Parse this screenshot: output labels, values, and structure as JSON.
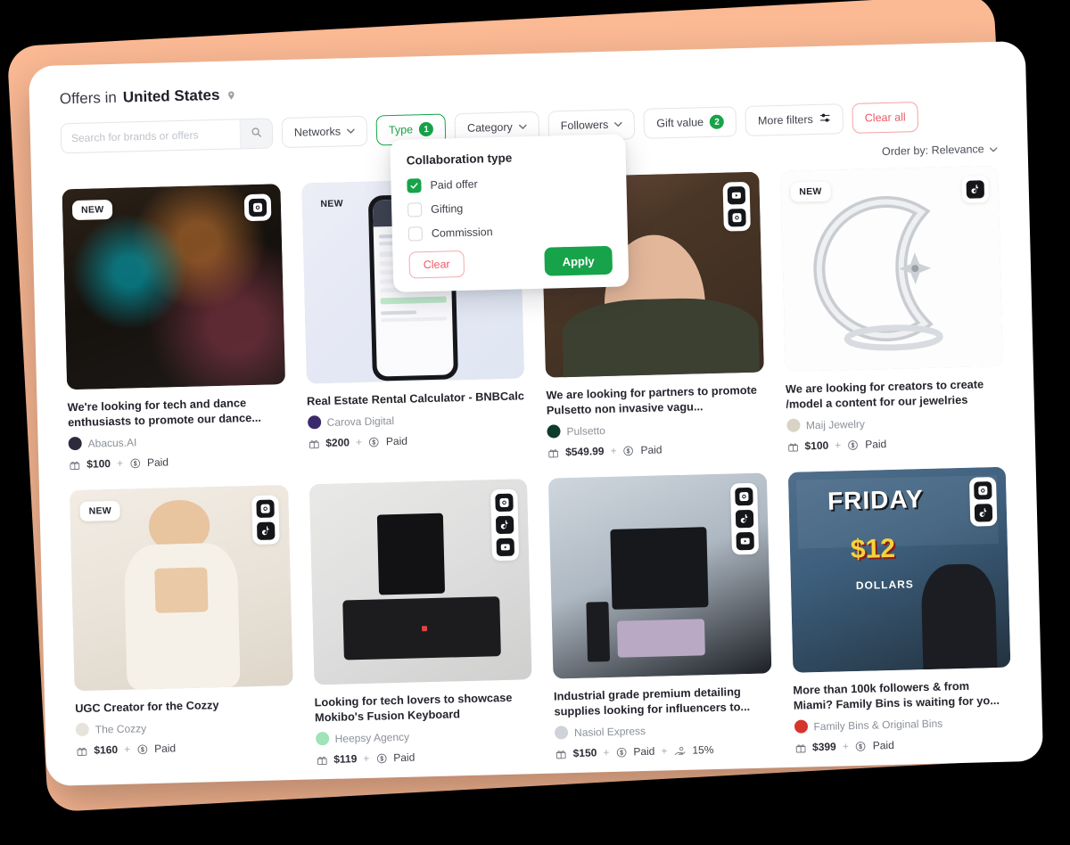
{
  "header": {
    "title_prefix": "Offers in",
    "country": "United States",
    "pin_icon": "location-pin-icon"
  },
  "search": {
    "placeholder": "Search for brands or offers",
    "value": "",
    "icon": "search-icon"
  },
  "filters": [
    {
      "label": "Networks",
      "caret": "⌄",
      "state": "default",
      "count": null
    },
    {
      "label": "Type",
      "caret": "",
      "state": "active",
      "count": "1"
    },
    {
      "label": "Category",
      "caret": "⌄",
      "state": "default",
      "count": null
    },
    {
      "label": "Followers",
      "caret": "⌄",
      "state": "default",
      "count": null
    },
    {
      "label": "Gift value",
      "caret": "",
      "state": "default",
      "count": "2"
    },
    {
      "label": "More filters",
      "caret": "",
      "state": "default",
      "count": null,
      "icon": "sliders-icon"
    },
    {
      "label": "Clear all",
      "caret": "",
      "state": "danger",
      "count": null
    }
  ],
  "order_by": {
    "label": "Order by: Relevance",
    "caret": "⌄"
  },
  "dropdown": {
    "title": "Collaboration type",
    "options": [
      {
        "label": "Paid offer",
        "checked": true
      },
      {
        "label": "Gifting",
        "checked": false
      },
      {
        "label": "Commission",
        "checked": false
      }
    ],
    "clear_label": "Clear",
    "apply_label": "Apply"
  },
  "cards": [
    {
      "title": "We're looking for tech and dance enthusiasts to promote our dance...",
      "brand": "Abacus.AI",
      "brand_color": "#2b2b3c",
      "new": true,
      "new_label": "NEW",
      "socials": [
        "instagram"
      ],
      "gift_value": "$100",
      "payment": "Paid",
      "commission": null,
      "img_kind": "concert-crowd-confetti"
    },
    {
      "title": "Real Estate Rental Calculator - BNBCalc",
      "brand": "Carova Digital",
      "brand_color": "#3b2a6b",
      "new": true,
      "new_label": "NEW",
      "socials": [],
      "gift_value": "$200",
      "payment": "Paid",
      "commission": null,
      "img_kind": "phone-app-screenshot"
    },
    {
      "title": "We are looking for partners to promote Pulsetto non invasive vagu...",
      "brand": "Pulsetto",
      "brand_color": "#0d3b2e",
      "new": false,
      "new_label": "",
      "socials": [
        "youtube",
        "instagram"
      ],
      "gift_value": "$549.99",
      "payment": "Paid",
      "commission": null,
      "img_kind": "woman-portrait-device"
    },
    {
      "title": "We are looking for creators to create /model a content for our jewelries",
      "brand": "Maij Jewelry",
      "brand_color": "#d8d3c4",
      "new": true,
      "new_label": "NEW",
      "socials": [
        "tiktok"
      ],
      "gift_value": "$100",
      "payment": "Paid",
      "commission": null,
      "img_kind": "crescent-moon-ring"
    },
    {
      "title": "UGC Creator for the Cozzy",
      "brand": "The Cozzy",
      "brand_color": "#e6e3dd",
      "new": true,
      "new_label": "NEW",
      "socials": [
        "instagram",
        "tiktok"
      ],
      "gift_value": "$160",
      "payment": "Paid",
      "commission": null,
      "img_kind": "woman-cream-loungewear"
    },
    {
      "title": "Looking for tech lovers to showcase Mokibo's Fusion Keyboard",
      "brand": "Heepsy Agency",
      "brand_color": "#9fe3b6",
      "new": false,
      "new_label": "",
      "socials": [
        "instagram",
        "tiktok",
        "youtube"
      ],
      "gift_value": "$119",
      "payment": "Paid",
      "commission": null,
      "img_kind": "keyboard-desk-hands"
    },
    {
      "title": "Industrial grade premium detailing supplies looking for influencers to...",
      "brand": "Nasiol Express",
      "brand_color": "#cfd2d8",
      "new": false,
      "new_label": "",
      "socials": [
        "instagram",
        "tiktok",
        "youtube"
      ],
      "gift_value": "$150",
      "payment": "Paid",
      "commission": "15%",
      "img_kind": "car-detailing-kit"
    },
    {
      "title": "More than 100k followers & from Miami? Family Bins is waiting for yo...",
      "brand": "Family Bins & Original Bins",
      "brand_color": "#d6352e",
      "new": false,
      "new_label": "",
      "socials": [
        "instagram",
        "tiktok"
      ],
      "gift_value": "$399",
      "payment": "Paid",
      "commission": null,
      "img_kind": "friday-12-dollars-store"
    }
  ],
  "colors": {
    "accent_green": "#17a34a",
    "danger_red": "#ef5a68",
    "peach_backdrop": "#FBB994",
    "page_background": "#000000"
  }
}
